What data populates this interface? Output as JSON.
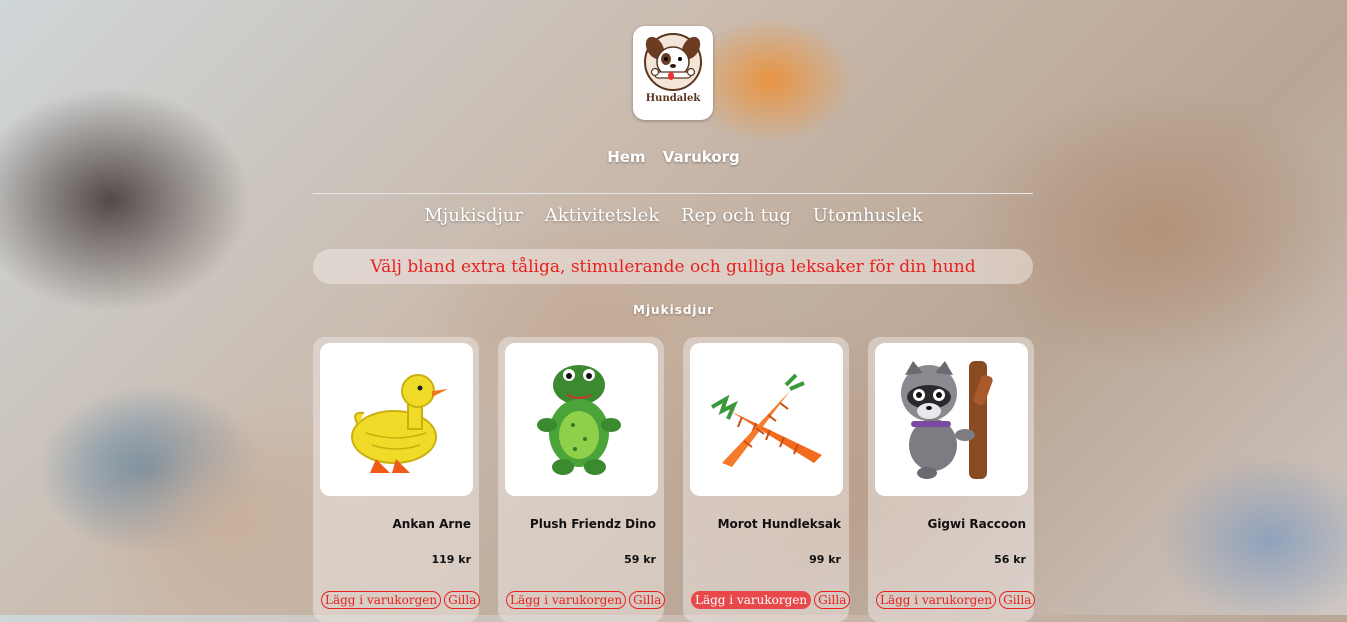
{
  "logo": {
    "text": "Hundalek"
  },
  "topnav": [
    "Hem",
    "Varukorg"
  ],
  "categories": [
    "Mjukisdjur",
    "Aktivitetslek",
    "Rep och tug",
    "Utomhuslek"
  ],
  "tagline": "Välj bland extra tåliga, stimulerande och gulliga leksaker för din hund",
  "section_title": "Mjukisdjur",
  "products": [
    {
      "name": "Ankan Arne",
      "price": "119 kr",
      "add_label": "Lägg i varukorgen",
      "like_label": "Gilla"
    },
    {
      "name": "Plush Friendz Dino",
      "price": "59 kr",
      "add_label": "Lägg i varukorgen",
      "like_label": "Gilla"
    },
    {
      "name": "Morot Hundleksak",
      "price": "99 kr",
      "add_label": "Lägg i varukorgen",
      "like_label": "Gilla"
    },
    {
      "name": "Gigwi Raccoon",
      "price": "56 kr",
      "add_label": "Lägg i varukorgen",
      "like_label": "Gilla"
    }
  ],
  "colors": {
    "accent": "#e8211f",
    "card_bg": "#ebe4e0"
  }
}
